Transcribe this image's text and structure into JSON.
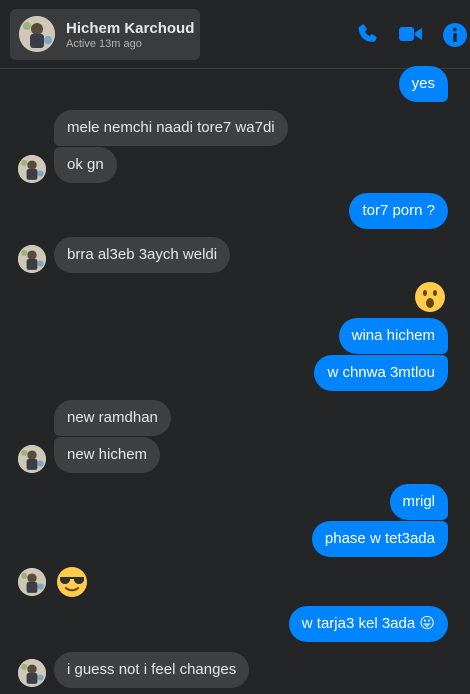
{
  "header": {
    "contact_name": "Hichem Karchoud",
    "status": "Active 13m ago",
    "icons": [
      "phone-icon",
      "video-icon",
      "info-icon"
    ]
  },
  "colors": {
    "accent": "#0084ff",
    "background": "#242526",
    "incoming_bubble": "#3e4042"
  },
  "messages": [
    {
      "sender": "me",
      "text": "yes"
    },
    {
      "sender": "contact",
      "text": "mele nemchi naadi tore7 wa7di"
    },
    {
      "sender": "contact",
      "text": "ok gn"
    },
    {
      "sender": "me",
      "text": "tor7 porn ?"
    },
    {
      "sender": "contact",
      "text": "brra al3eb 3aych weldi"
    },
    {
      "sender": "me",
      "text": "😮"
    },
    {
      "sender": "me",
      "text": "wina hichem"
    },
    {
      "sender": "me",
      "text": "w chnwa 3mtlou"
    },
    {
      "sender": "contact",
      "text": "new ramdhan"
    },
    {
      "sender": "contact",
      "text": "new hichem"
    },
    {
      "sender": "me",
      "text": "mrigl"
    },
    {
      "sender": "me",
      "text": "phase w tet3ada"
    },
    {
      "sender": "contact",
      "text": "😎"
    },
    {
      "sender": "me",
      "text": "w tarja3 kel 3ada 😛"
    },
    {
      "sender": "contact",
      "text": "i guess not i feel changes"
    }
  ]
}
